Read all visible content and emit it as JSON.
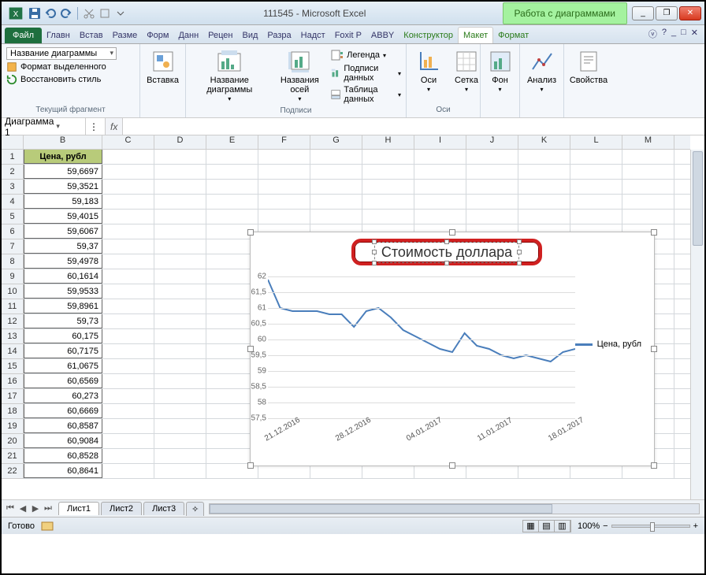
{
  "title": {
    "doc": "111545",
    "app": "Microsoft Excel",
    "context_group": "Работа с диаграммами"
  },
  "win": {
    "min": "_",
    "max": "❐",
    "close": "✕"
  },
  "tabs": {
    "file": "Файл",
    "items": [
      "Главн",
      "Встав",
      "Разме",
      "Форм",
      "Данн",
      "Рецен",
      "Вид",
      "Разра",
      "Надст",
      "Foxit P",
      "ABBY"
    ],
    "ctx": [
      "Конструктор",
      "Макет",
      "Формат"
    ],
    "active": "Макет"
  },
  "ribbon": {
    "selection": {
      "combo": "Название диаграммы",
      "format_sel": "Формат выделенного",
      "reset": "Восстановить стиль",
      "group": "Текущий фрагмент"
    },
    "insert": {
      "btn": "Вставка"
    },
    "labels": {
      "chart_title": "Название диаграммы",
      "axis_titles": "Названия осей",
      "legend": "Легенда",
      "data_labels": "Подписи данных",
      "data_table": "Таблица данных",
      "group": "Подписи"
    },
    "axes": {
      "axes": "Оси",
      "grid": "Сетка",
      "group": "Оси"
    },
    "bg": {
      "btn": "Фон"
    },
    "analysis": {
      "btn": "Анализ"
    },
    "props": {
      "btn": "Свойства"
    }
  },
  "namebox": {
    "name": "Диаграмма 1",
    "fx": "fx"
  },
  "columns": [
    "B",
    "C",
    "D",
    "E",
    "F",
    "G",
    "H",
    "I",
    "J",
    "K",
    "L",
    "M"
  ],
  "rows": [
    "1",
    "2",
    "3",
    "4",
    "5",
    "6",
    "7",
    "8",
    "9",
    "10",
    "11",
    "12",
    "13",
    "14",
    "15",
    "16",
    "17",
    "18",
    "19",
    "20",
    "21",
    "22"
  ],
  "data": {
    "header": "Цена, рубл",
    "values": [
      "59,6697",
      "59,3521",
      "59,183",
      "59,4015",
      "59,6067",
      "59,37",
      "59,4978",
      "60,1614",
      "59,9533",
      "59,8961",
      "59,73",
      "60,175",
      "60,7175",
      "61,0675",
      "60,6569",
      "60,273",
      "60,6669",
      "60,8587",
      "60,9084",
      "60,8528",
      "60,8641"
    ]
  },
  "chart_data": {
    "type": "line",
    "title": "Стоимость доллара",
    "series": [
      {
        "name": "Цена, рубл",
        "values": [
          61.9,
          61.0,
          60.9,
          60.9,
          60.9,
          60.8,
          60.8,
          60.4,
          60.9,
          61.0,
          60.7,
          60.3,
          60.1,
          59.9,
          59.7,
          59.6,
          60.2,
          59.8,
          59.7,
          59.5,
          59.4,
          59.5,
          59.4,
          59.3,
          59.6,
          59.7
        ]
      }
    ],
    "x_categories": [
      "21.12.2016",
      "28.12.2016",
      "04.01.2017",
      "11.01.2017",
      "18.01.2017"
    ],
    "yticks": [
      "57,5",
      "58",
      "58,5",
      "59",
      "59,5",
      "60",
      "60,5",
      "61",
      "61,5",
      "62"
    ],
    "ylim": [
      57.5,
      62
    ],
    "legend": "Цена, рубл",
    "color": "#4a7ebb"
  },
  "sheet_tabs": {
    "items": [
      "Лист1",
      "Лист2",
      "Лист3"
    ],
    "active": "Лист1"
  },
  "status": {
    "ready": "Готово",
    "zoom": "100%",
    "minus": "−",
    "plus": "+"
  }
}
